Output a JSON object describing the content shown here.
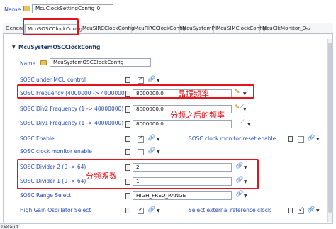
{
  "header": {
    "name_label": "Name",
    "name_value": "McuClockSettingConfig_0"
  },
  "tabs": [
    {
      "label": "Genera"
    },
    {
      "label": "McuSOSCClockConfig"
    },
    {
      "label": "McuSIRCClockConfig"
    },
    {
      "label": "McuFIRCClockConfig"
    },
    {
      "label": "McuSystemPll"
    },
    {
      "label": "McuSIMClockConfig"
    },
    {
      "label": "McuClkMonitor_0"
    },
    {
      "label": "»₂"
    }
  ],
  "section": {
    "title": "McuSystemOSCClockConfig",
    "name_label": "Name",
    "name_value": "McuSystemOSCClockConfig"
  },
  "rows": {
    "sosc_under_mcu_control": "SOSC under MCU control",
    "sosc_frequency": "SOSC Frequency (4000000 -> 40000000)",
    "sosc_frequency_value": "8000000.0",
    "sosc_div2_freq": "SOSC Div2 Frequency (1 -> 40000000)",
    "sosc_div2_freq_value": "8000000.0",
    "sosc_div1_freq": "SOSC Div1 Frequency (1 -> 40000000)",
    "sosc_div1_freq_value": "8000000.0",
    "sosc_enable": "SOSC Enable",
    "sosc_clock_monitor_reset": "SOSC clock monitor reset enable",
    "sosc_clock_monitor_enable": "SOSC clock monitor enable",
    "sosc_divider2": "SOSC Divider 2 (0 -> 64)",
    "sosc_divider2_value": "2",
    "sosc_divider1": "SOSC Divider 1 (0 -> 64)",
    "sosc_divider1_value": "1",
    "sosc_range_select": "SOSC Range Select",
    "sosc_range_select_value": "HIGH_FREQ_RANGE",
    "high_gain_osc_select": "High Gain Oscillator Select",
    "select_external_reference_clock": "Select external reference clock"
  },
  "annotations": {
    "crystal_freq": "晶振频率",
    "after_div_freq": "分频之后的频率",
    "div_factor": "分频系数"
  },
  "footer": {
    "tab": "Default"
  },
  "colors": {
    "annotation_red": "#e3141b",
    "link_blue": "#2a4fb5"
  }
}
